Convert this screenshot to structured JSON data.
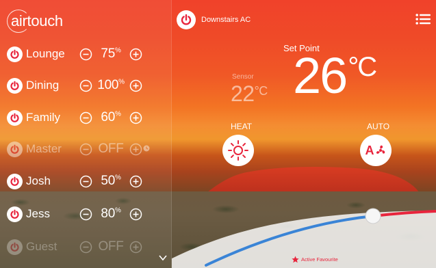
{
  "app": {
    "logo_text": "airtouch"
  },
  "zones": [
    {
      "name": "Lounge",
      "value": "75",
      "unit": "%",
      "state": "on"
    },
    {
      "name": "Dining",
      "value": "100",
      "unit": "%",
      "state": "on"
    },
    {
      "name": "Family",
      "value": "60",
      "unit": "%",
      "state": "on"
    },
    {
      "name": "Master",
      "value": "OFF",
      "unit": "",
      "state": "off"
    },
    {
      "name": "Josh",
      "value": "50",
      "unit": "%",
      "state": "on"
    },
    {
      "name": "Jess",
      "value": "80",
      "unit": "%",
      "state": "on"
    },
    {
      "name": "Guest",
      "value": "OFF",
      "unit": "",
      "state": "off"
    }
  ],
  "ac": {
    "name": "Downstairs AC",
    "setpoint_label": "Set Point",
    "setpoint_value": "26",
    "setpoint_unit": "°C",
    "sensor_label": "Sensor",
    "sensor_value": "22",
    "sensor_unit": "°C",
    "mode_label": "HEAT",
    "fan_label": "AUTO",
    "fan_icon_text": "A",
    "active_favourite": "Active Favourite"
  },
  "colors": {
    "accent_red": "#e8243c",
    "slider_blue": "#3a84d6",
    "slider_red": "#e8243c"
  }
}
